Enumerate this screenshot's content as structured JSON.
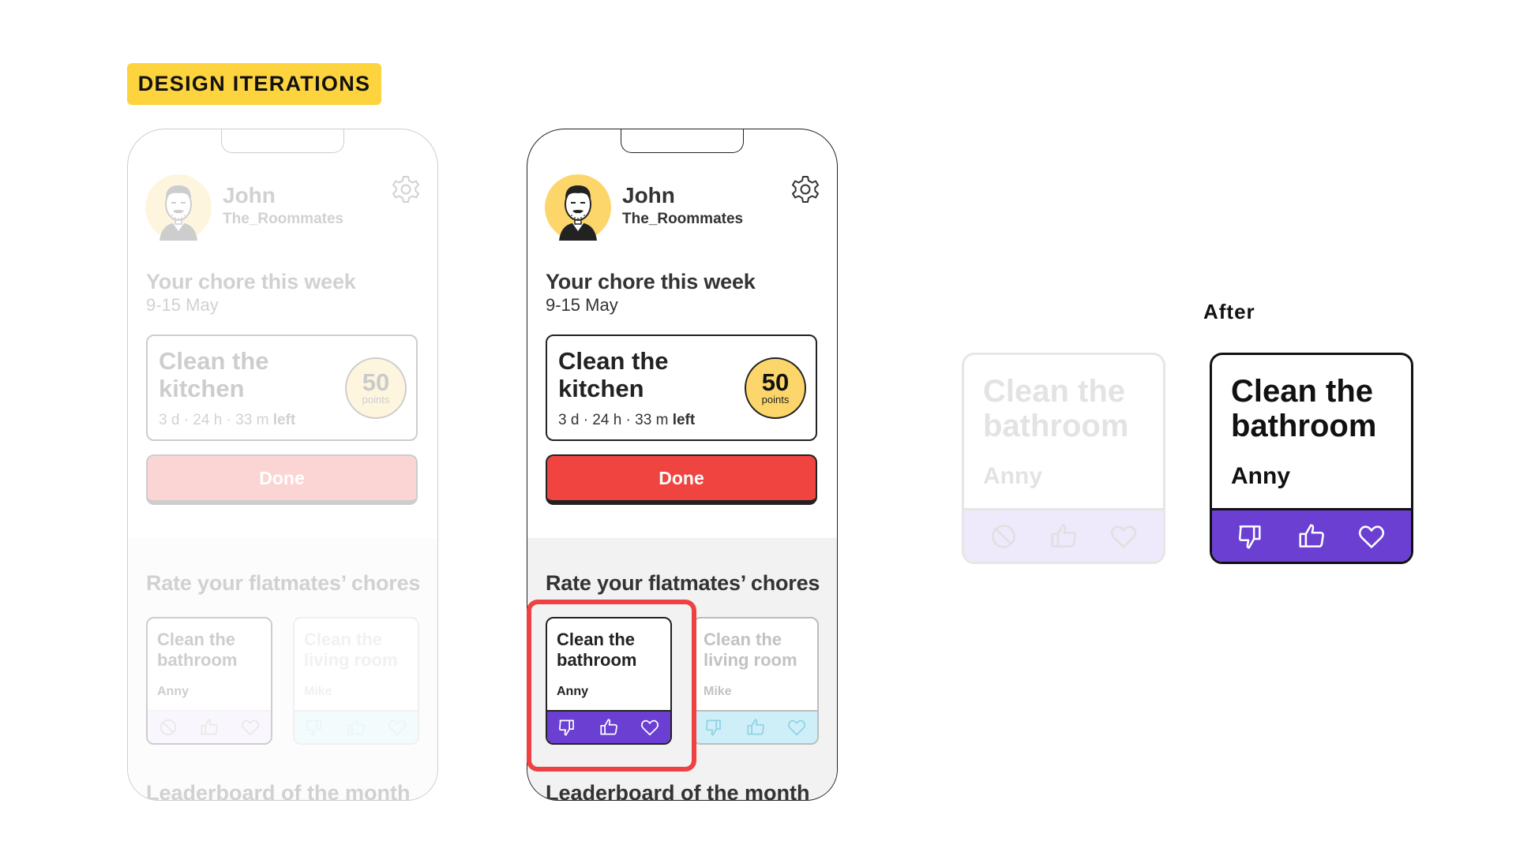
{
  "tag": "DESIGN ITERATIONS",
  "colors": {
    "tag_yellow": "#FDD33E",
    "done_red": "#F04440",
    "rating_purple": "#6A3FD2",
    "rating_blue": "#CFEFF8",
    "highlight_red": "#EF4141"
  },
  "user": {
    "name": "John",
    "group": "The_Roommates",
    "avatar_icon": "avatar-man-icon",
    "settings_icon": "gear-icon"
  },
  "chore": {
    "heading": "Your chore this week",
    "dates": "9-15 May",
    "title": "Clean the kitchen",
    "time_left": "3 d · 24 h · 33 m",
    "left_label": "left",
    "points_value": "50",
    "points_unit": "points"
  },
  "done_label": "Done",
  "rate": {
    "heading": "Rate your flatmates’ chores",
    "cards": [
      {
        "title": "Clean the bathroom",
        "assignee": "Anny"
      },
      {
        "title": "Clean the living room",
        "assignee": "Mike"
      }
    ],
    "icons": [
      "thumbs-down-icon",
      "thumbs-up-icon",
      "heart-icon"
    ]
  },
  "leaderboard_heading": "Leaderboard of the month",
  "after": {
    "label": "After",
    "title": "Clean the bathroom",
    "assignee": "Anny"
  }
}
